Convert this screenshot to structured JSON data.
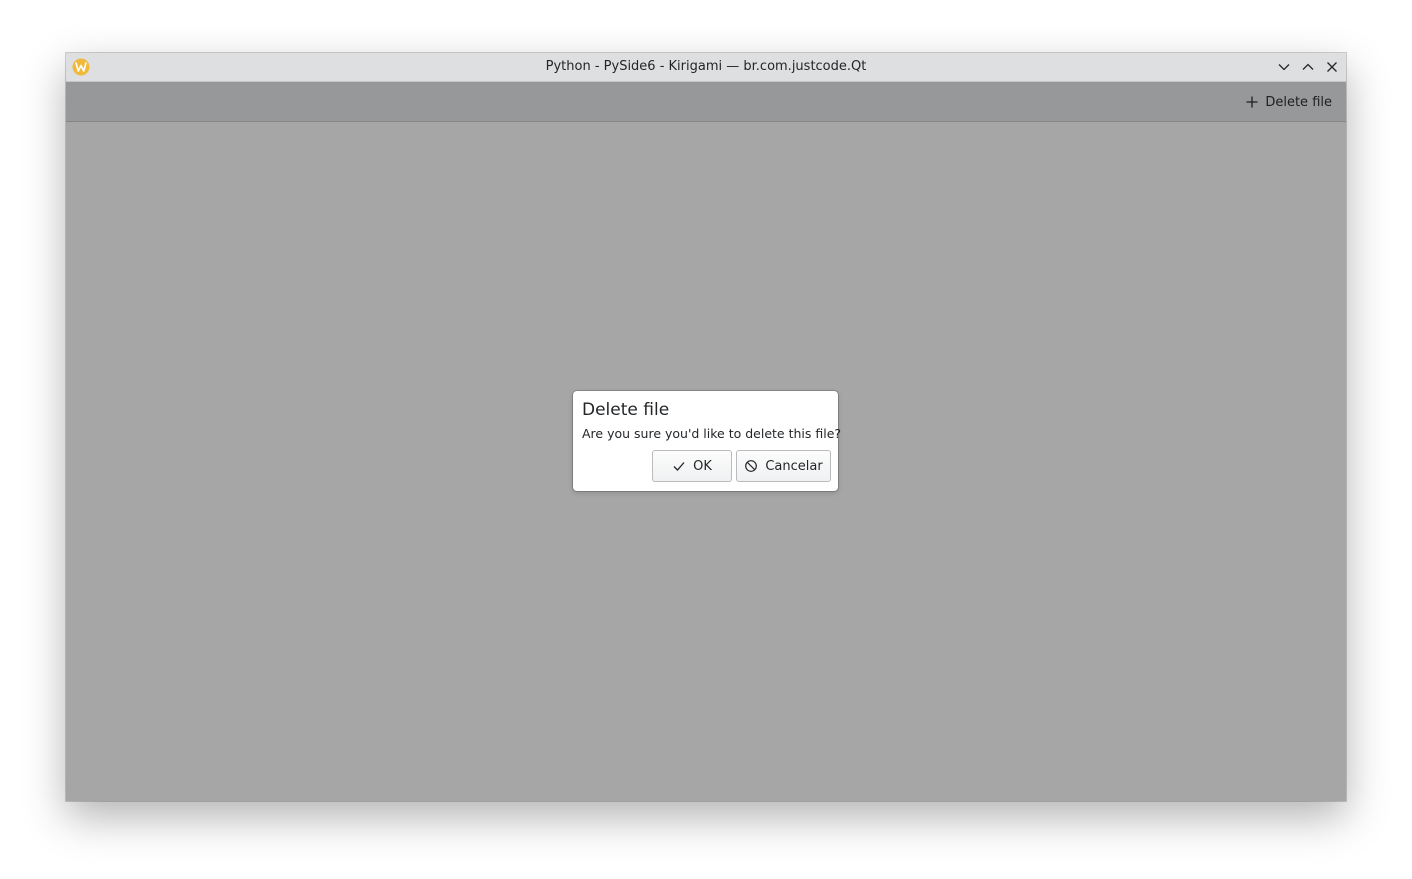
{
  "window": {
    "title": "Python - PySide6 - Kirigami — br.com.justcode.Qt",
    "app_icon": "kde-w-logo-icon",
    "controls": [
      "minimize-icon",
      "maximize-icon",
      "close-icon"
    ]
  },
  "toolbar": {
    "action_label": "Delete file",
    "action_icon": "plus-icon"
  },
  "dialog": {
    "title": "Delete file",
    "message": "Are you sure you'd like to delete this file?",
    "ok_label": "OK",
    "ok_icon": "checkmark-icon",
    "cancel_label": "Cancelar",
    "cancel_icon": "cancel-icon"
  },
  "colors": {
    "titlebar": "#dedfe0",
    "toolbar": "#979899",
    "overlay": "#a6a6a6",
    "dialog": "#ffffff",
    "app_icon_accent": "#f1b93c"
  }
}
